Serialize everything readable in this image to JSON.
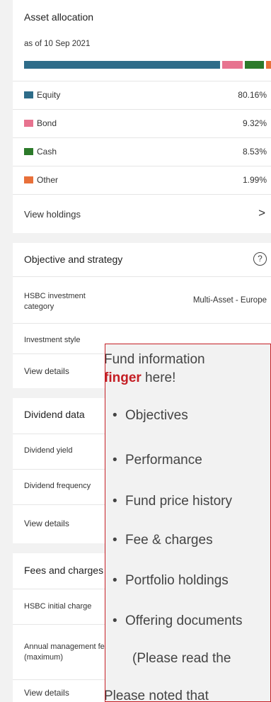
{
  "asset_allocation": {
    "title": "Asset allocation",
    "as_of": "as of 10 Sep 2021",
    "bar": [
      {
        "name": "Equity",
        "pct": 80.16,
        "color": "#2e6c89"
      },
      {
        "name": "Bond",
        "pct": 9.32,
        "color": "#e7738f"
      },
      {
        "name": "Cash",
        "pct": 8.53,
        "color": "#2c7a2a"
      },
      {
        "name": "Other",
        "pct": 1.99,
        "color": "#e8703a"
      }
    ],
    "items": [
      {
        "label": "Equity",
        "value": "80.16%",
        "color": "#2e6c89"
      },
      {
        "label": "Bond",
        "value": "9.32%",
        "color": "#e7738f"
      },
      {
        "label": "Cash",
        "value": "8.53%",
        "color": "#2c7a2a"
      },
      {
        "label": "Other",
        "value": "1.99%",
        "color": "#e8703a"
      }
    ],
    "view_holdings": "View holdings",
    "chevron": ">"
  },
  "objective": {
    "title": "Objective and strategy",
    "help_icon": "?",
    "category_label_1": "HSBC investment",
    "category_label_2": "category",
    "category_value": "Multi-Asset - Europe",
    "style_label": "Investment style",
    "view_details": "View details"
  },
  "dividend": {
    "title": "Dividend data",
    "yield_label": "Dividend yield",
    "frequency_label": "Dividend frequency",
    "view_details": "View details"
  },
  "fees": {
    "title": "Fees and charges",
    "initial_label": "HSBC initial charge",
    "annual_label_1": "Annual management fee",
    "annual_label_2": "(maximum)",
    "view_details": "View details"
  },
  "overlay": {
    "line1": "Fund information",
    "line2_red": "finger",
    "line2_rest": " here!",
    "bullets": [
      "Objectives",
      "Performance",
      "Fund price history",
      "Fee & charges",
      "Portfolio holdings",
      "Offering documents"
    ],
    "note": "(Please read the",
    "footer": "Please noted that"
  }
}
